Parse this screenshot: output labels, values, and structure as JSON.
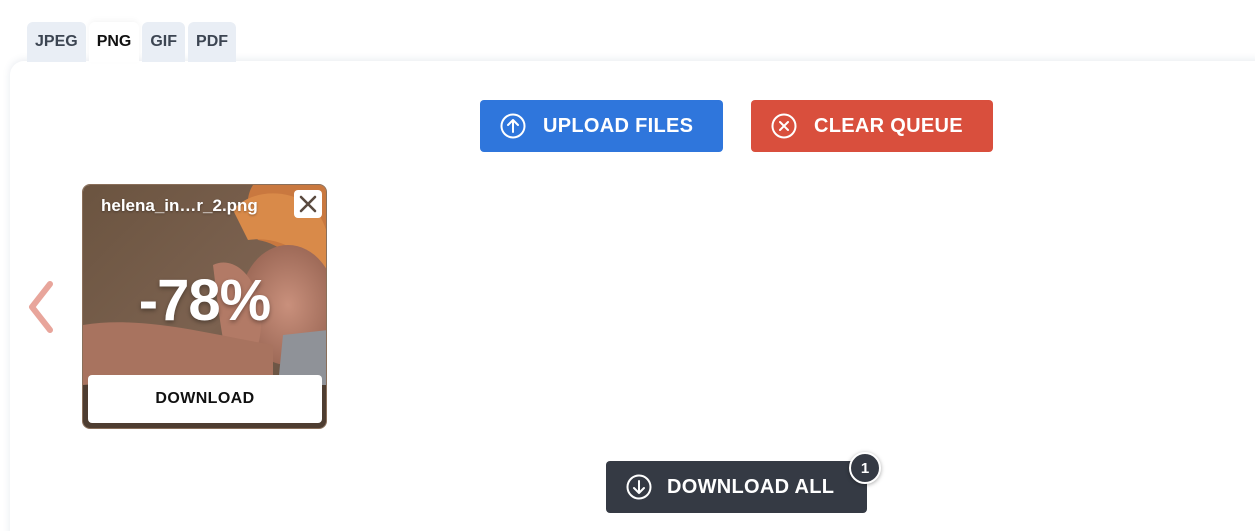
{
  "tabs": [
    {
      "label": "JPEG",
      "active": false
    },
    {
      "label": "PNG",
      "active": true
    },
    {
      "label": "GIF",
      "active": false
    },
    {
      "label": "PDF",
      "active": false
    }
  ],
  "toolbar": {
    "upload_label": "UPLOAD FILES",
    "upload_icon": "arrow-up-circle-icon",
    "clear_label": "CLEAR QUEUE",
    "clear_icon": "x-circle-icon"
  },
  "queue": {
    "prev_icon": "chevron-left-icon",
    "files": [
      {
        "name": "helena_in…r_2.png",
        "saving": "-78%",
        "download_label": "DOWNLOAD",
        "remove_icon": "close-icon"
      }
    ]
  },
  "footer": {
    "download_all_label": "DOWNLOAD ALL",
    "download_all_icon": "arrow-down-circle-icon",
    "count": "1"
  },
  "colors": {
    "upload": "#2f76dc",
    "clear": "#d94f3d",
    "download_all": "#353a44",
    "prev_arrow": "#e8a59b"
  }
}
